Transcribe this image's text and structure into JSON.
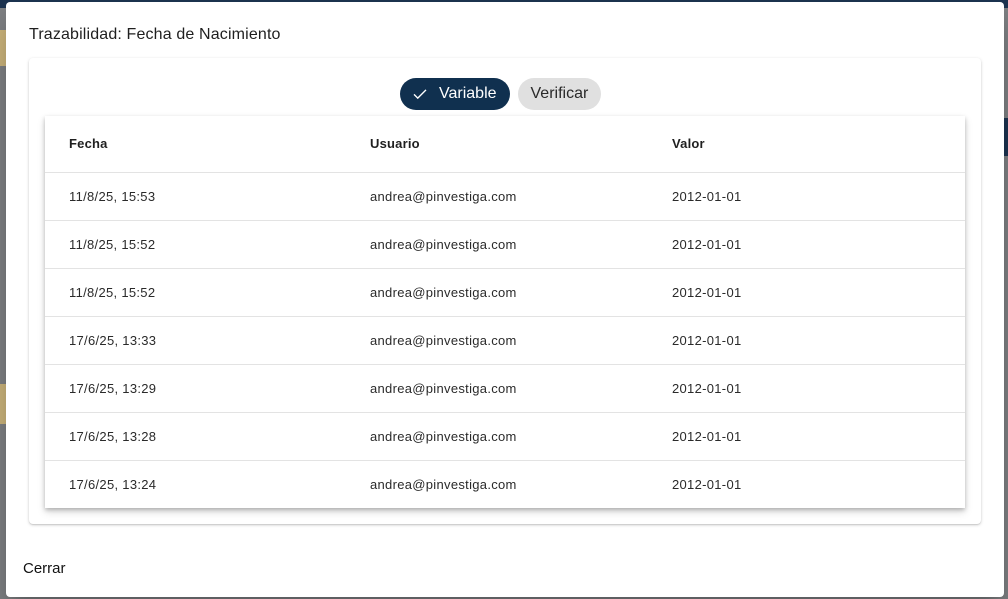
{
  "dialog": {
    "title": "Trazabilidad: Fecha de Nacimiento",
    "close_label": "Cerrar"
  },
  "toggle": {
    "options": [
      {
        "label": "Variable",
        "selected": true,
        "icon": "check-icon"
      },
      {
        "label": "Verificar",
        "selected": false
      }
    ]
  },
  "table": {
    "columns": [
      "Fecha",
      "Usuario",
      "Valor"
    ],
    "rows": [
      [
        "11/8/25, 15:53",
        "andrea@pinvestiga.com",
        "2012-01-01"
      ],
      [
        "11/8/25, 15:52",
        "andrea@pinvestiga.com",
        "2012-01-01"
      ],
      [
        "11/8/25, 15:52",
        "andrea@pinvestiga.com",
        "2012-01-01"
      ],
      [
        "17/6/25, 13:33",
        "andrea@pinvestiga.com",
        "2012-01-01"
      ],
      [
        "17/6/25, 13:29",
        "andrea@pinvestiga.com",
        "2012-01-01"
      ],
      [
        "17/6/25, 13:28",
        "andrea@pinvestiga.com",
        "2012-01-01"
      ],
      [
        "17/6/25, 13:24",
        "andrea@pinvestiga.com",
        "2012-01-01"
      ]
    ]
  },
  "colors": {
    "accent": "#10304f",
    "chip_unselected": "#e0e0e0"
  }
}
